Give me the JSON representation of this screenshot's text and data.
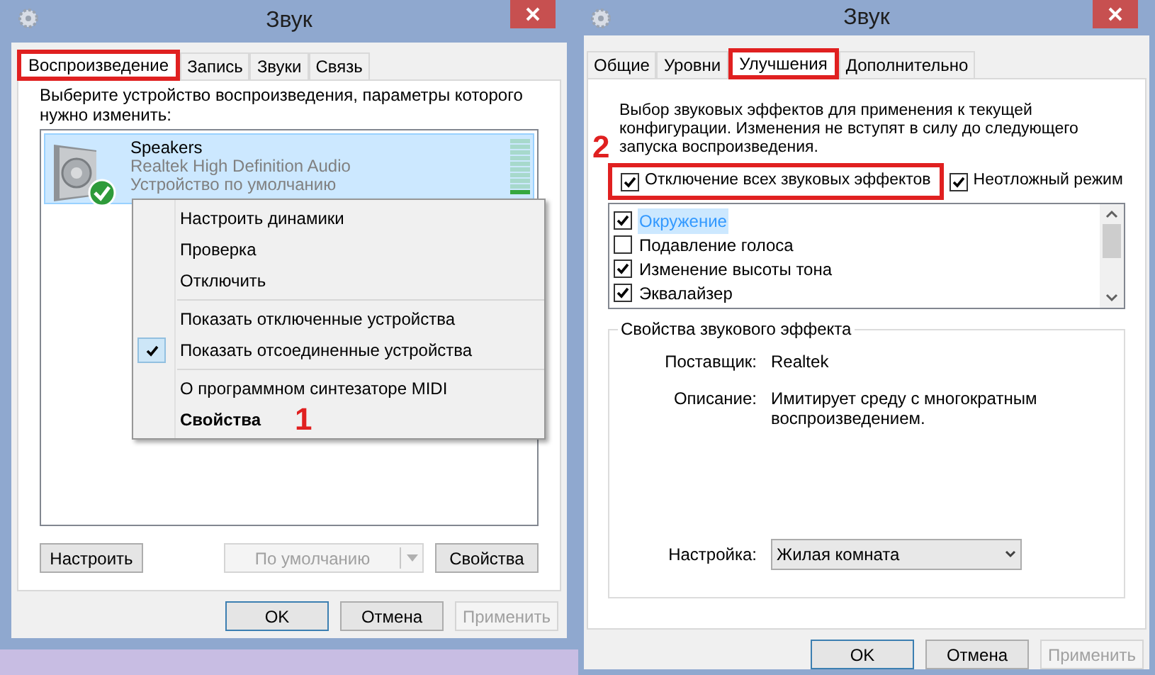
{
  "playback_dialog": {
    "title": "Звук",
    "tabs": [
      {
        "label": "Воспроизведение",
        "selected": true,
        "highlighted": true
      },
      {
        "label": "Запись",
        "selected": false,
        "highlighted": false
      },
      {
        "label": "Звуки",
        "selected": false,
        "highlighted": false
      },
      {
        "label": "Связь",
        "selected": false,
        "highlighted": false
      }
    ],
    "instruction": "Выберите устройство воспроизведения, параметры которого нужно изменить:",
    "devices": [
      {
        "name": "Speakers",
        "driver": "Realtek High Definition Audio",
        "status": "Устройство по умолчанию",
        "selected": true,
        "default": true,
        "level": 0.1
      }
    ],
    "context_menu": [
      [
        {
          "label": "Настроить динамики",
          "checked": false,
          "default": false
        },
        {
          "label": "Проверка",
          "checked": false,
          "default": false
        },
        {
          "label": "Отключить",
          "checked": false,
          "default": false
        }
      ],
      [
        {
          "label": "Показать отключенные устройства",
          "checked": false,
          "default": false
        },
        {
          "label": "Показать отсоединенные устройства",
          "checked": true,
          "default": false
        }
      ],
      [
        {
          "label": "О программном синтезаторе MIDI",
          "checked": false,
          "default": false
        },
        {
          "label": "Свойства",
          "checked": false,
          "default": true
        }
      ]
    ],
    "annotation": "1",
    "panel_buttons": [
      {
        "label": "Настроить",
        "kind": "button",
        "disabled": false
      },
      {
        "label": "По умолчанию",
        "kind": "split",
        "disabled": true
      },
      {
        "label": "Свойства",
        "kind": "button",
        "disabled": false
      }
    ],
    "buttons": [
      {
        "label": "OK",
        "default": true,
        "disabled": false
      },
      {
        "label": "Отмена",
        "default": false,
        "disabled": false
      },
      {
        "label": "Применить",
        "default": false,
        "disabled": true
      }
    ]
  },
  "enhancements_dialog": {
    "title": "Звук",
    "tabs": [
      {
        "label": "Общие",
        "selected": false,
        "highlighted": false
      },
      {
        "label": "Уровни",
        "selected": false,
        "highlighted": false
      },
      {
        "label": "Улучшения",
        "selected": true,
        "highlighted": true
      },
      {
        "label": "Дополнительно",
        "selected": false,
        "highlighted": false
      }
    ],
    "description": "Выбор звуковых эффектов для применения к текущей конфигурации. Изменения не вступят в силу до следующего запуска воспроизведения.",
    "annotation": "2",
    "options": [
      {
        "label": "Отключение всех звуковых эффектов",
        "checked": true,
        "highlighted": true
      },
      {
        "label": "Неотложный режим",
        "checked": true,
        "highlighted": false
      }
    ],
    "effects": [
      {
        "label": "Окружение",
        "checked": true,
        "selected": true
      },
      {
        "label": "Подавление голоса",
        "checked": false,
        "selected": false
      },
      {
        "label": "Изменение высоты тона",
        "checked": true,
        "selected": false
      },
      {
        "label": "Эквалайзер",
        "checked": true,
        "selected": false
      }
    ],
    "properties": {
      "title": "Свойства звукового эффекта",
      "provider_label": "Поставщик:",
      "provider": "Realtek",
      "description_label": "Описание:",
      "description": "Имитирует среду с многократным воспроизведением.",
      "setting_label": "Настройка:",
      "setting": "Жилая комната"
    },
    "buttons": [
      {
        "label": "OK",
        "default": true,
        "disabled": false
      },
      {
        "label": "Отмена",
        "default": false,
        "disabled": false
      },
      {
        "label": "Применить",
        "default": false,
        "disabled": true
      }
    ]
  }
}
